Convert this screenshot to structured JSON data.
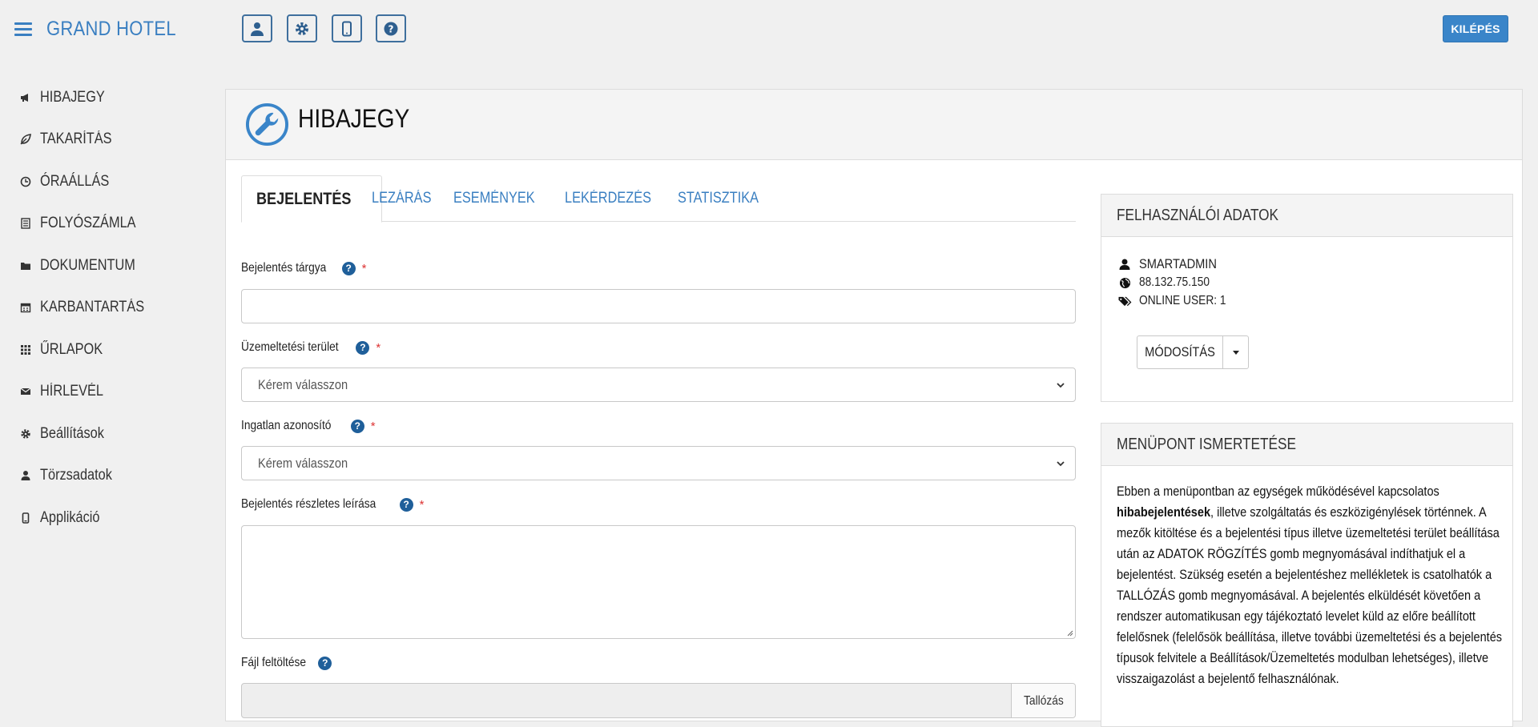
{
  "header": {
    "brand": "GRAND HOTEL",
    "tool_icons": [
      "user-icon",
      "gear-icon",
      "mobile-icon",
      "help-icon"
    ],
    "logout_label": "KILÉPÉS"
  },
  "sidebar": {
    "items": [
      {
        "label": "HIBAJEGY",
        "icon": "megaphone-icon"
      },
      {
        "label": "TAKARÍTÁS",
        "icon": "leaf-icon"
      },
      {
        "label": "ÓRAÁLLÁS",
        "icon": "clock-icon"
      },
      {
        "label": "FOLYÓSZÁMLA",
        "icon": "list-icon"
      },
      {
        "label": "DOKUMENTUM",
        "icon": "folder-icon"
      },
      {
        "label": "KARBANTARTÁS",
        "icon": "calendar-icon"
      },
      {
        "label": "ŰRLAPOK",
        "icon": "grid-icon"
      },
      {
        "label": "HÍRLEVÉL",
        "icon": "envelope-icon"
      },
      {
        "label": "Beállítások",
        "icon": "cog-icon"
      },
      {
        "label": "Törzsadatok",
        "icon": "person-icon"
      },
      {
        "label": "Applikáció",
        "icon": "phone-icon"
      }
    ]
  },
  "main": {
    "title": "HIBAJEGY",
    "tabs": [
      {
        "label": "BEJELENTÉS",
        "active": true
      },
      {
        "label": "LEZÁRÁS",
        "active": false
      },
      {
        "label": "ESEMÉNYEK",
        "active": false
      },
      {
        "label": "LEKÉRDEZÉS",
        "active": false
      },
      {
        "label": "STATISZTIKA",
        "active": false
      }
    ],
    "form": {
      "subject": {
        "label": "Bejelentés tárgya",
        "value": "",
        "required_mark": "*"
      },
      "area": {
        "label": "Üzemeltetési terület",
        "selected": "Kérem válasszon",
        "required_mark": "*"
      },
      "property": {
        "label": "Ingatlan azonosító",
        "selected": "Kérem válasszon",
        "required_mark": "*"
      },
      "details": {
        "label": "Bejelentés részletes leírása",
        "value": "",
        "required_mark": "*"
      },
      "file": {
        "label": "Fájl feltöltése",
        "browse_label": "Tallózás"
      }
    }
  },
  "user_card": {
    "title": "FELHASZNÁLÓI ADATOK",
    "username": "SMARTADMIN",
    "ip": "88.132.75.150",
    "online_users": "ONLINE USER: 1",
    "modify_label": "MÓDOSÍTÁS"
  },
  "desc_card": {
    "title": "MENÜPONT ISMERTETÉSE",
    "text_before": "Ebben a menüpontban az egységek működésével kapcsolatos ",
    "text_bold": "hibabejelentések",
    "text_after": ", illetve szolgáltatás és eszközigénylések történnek. A mezők kitöltése és a bejelentési típus illetve üzemeltetési terület beállítása után az ADATOK RÖGZÍTÉS gomb megnyomásával indíthatjuk el a bejelentést. Szükség esetén a bejelentéshez mellékletek is csatolhatók a TALLÓZÁS gomb megnyomásával. A bejelentés elküldését követően a rendszer automatikusan egy tájékoztató levelet küld az előre beállított felelősnek (felelősök beállítása, illetve további üzemeltetési és a bejelentés típusok felvitele a Beállítások/Üzemeltetés modulban lehetséges), illetve visszaigazolást a bejelentő felhasználónak."
  },
  "colors": {
    "accent": "#3a7fc1",
    "logout_bg": "#3a85c9",
    "help_icon": "#1f5f9a",
    "required": "#d33333"
  }
}
